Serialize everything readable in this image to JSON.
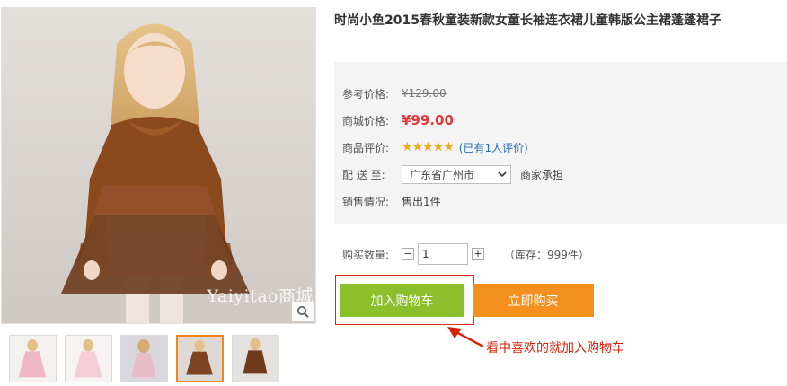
{
  "product": {
    "title": "时尚小鱼2015春秋童装新款女童长袖连衣裙儿童韩版公主裙蓬蓬裙子",
    "watermark": "Yaiyitao商城"
  },
  "info": {
    "ref_price_label": "参考价格:",
    "ref_price": "¥129.00",
    "mall_price_label": "商城价格:",
    "mall_price": "¥99.00",
    "rating_label": "商品评价:",
    "rating_stars": 5,
    "rating_glyphs": "★★★★★",
    "review_text": "(已有1人评价)",
    "ship_label": "配 送 至:",
    "ship_region": "广东省广州市",
    "ship_note": "商家承担",
    "sales_label": "销售情况:",
    "sales_value": "售出1件"
  },
  "purchase": {
    "qty_label": "购买数量:",
    "qty_minus": "−",
    "qty_plus": "+",
    "qty_value": "1",
    "stock_text": "（库存：999件）",
    "add_to_cart": "加入购物车",
    "buy_now": "立即购买"
  },
  "annotation": {
    "callout": "看中喜欢的就加入购物车",
    "color": "#d81e06"
  },
  "colors": {
    "price_red": "#e4393c",
    "cart_green": "#8bbf2c",
    "buy_orange": "#f4901e",
    "link_blue": "#2a6fb6",
    "thumb_active": "#f08819"
  },
  "thumbnails": [
    {
      "icon": "pink-dress-photo",
      "active": false
    },
    {
      "icon": "light-pink-dress-photo",
      "active": false
    },
    {
      "icon": "back-view-dress-photo",
      "active": false
    },
    {
      "icon": "brown-dress-photo",
      "active": true
    },
    {
      "icon": "brown-dress-full-photo",
      "active": false
    }
  ],
  "icons": {
    "zoom": "magnifier-icon",
    "dropdown": "chevron-down-icon",
    "arrow": "arrow-icon"
  }
}
